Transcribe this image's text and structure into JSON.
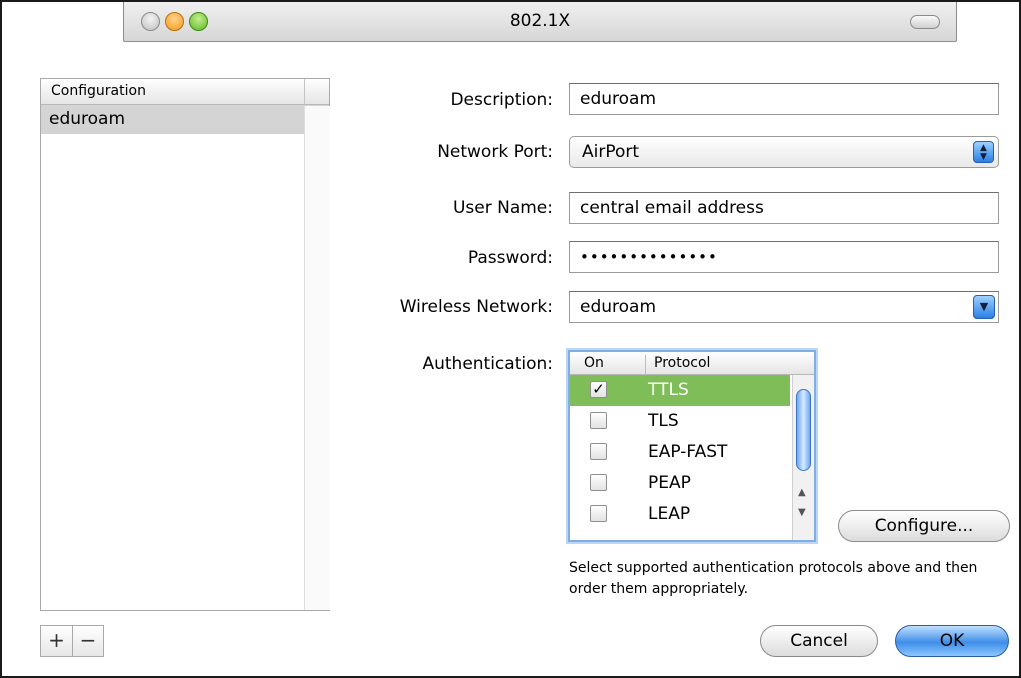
{
  "window": {
    "title": "802.1X"
  },
  "config_list": {
    "header": "Configuration",
    "items": [
      {
        "label": "eduroam"
      }
    ],
    "add_label": "+",
    "remove_label": "−"
  },
  "form": {
    "description": {
      "label": "Description:",
      "value": "eduroam"
    },
    "network_port": {
      "label": "Network Port:",
      "value": "AirPort"
    },
    "user_name": {
      "label": "User Name:",
      "value": "central email address"
    },
    "password": {
      "label": "Password:",
      "value": "••••••••••••••"
    },
    "wireless_network": {
      "label": "Wireless Network:",
      "value": "eduroam"
    },
    "authentication": {
      "label": "Authentication:",
      "col_on": "On",
      "col_protocol": "Protocol",
      "protocols": [
        {
          "name": "TTLS",
          "checked": true,
          "selected": true
        },
        {
          "name": "TLS",
          "checked": false,
          "selected": false
        },
        {
          "name": "EAP-FAST",
          "checked": false,
          "selected": false
        },
        {
          "name": "PEAP",
          "checked": false,
          "selected": false
        },
        {
          "name": "LEAP",
          "checked": false,
          "selected": false
        }
      ]
    }
  },
  "buttons": {
    "configure": "Configure...",
    "cancel": "Cancel",
    "ok": "OK"
  },
  "hint": "Select supported authentication protocols above and then order them appropriately.",
  "colors": {
    "selection": "#7fbd58",
    "default_button": "#3f8ee8",
    "focus_ring": "#7eaee6"
  },
  "icons": {
    "checkmark": "✓"
  }
}
